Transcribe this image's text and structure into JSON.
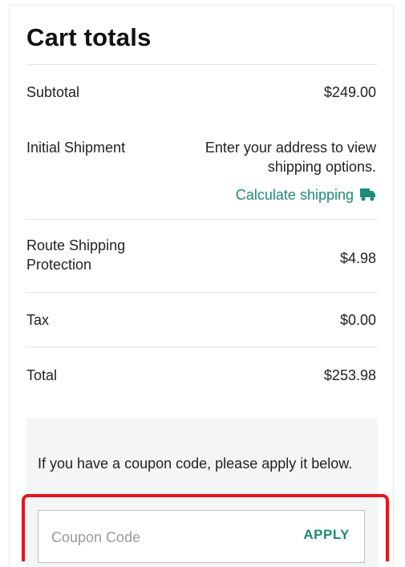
{
  "cart": {
    "title": "Cart totals",
    "subtotal_label": "Subtotal",
    "subtotal_value": "$249.00",
    "shipment_label": "Initial Shipment",
    "shipment_text": "Enter your address to view shipping options.",
    "calculate_shipping_label": "Calculate shipping",
    "route_label": "Route Shipping Protection",
    "route_value": "$4.98",
    "tax_label": "Tax",
    "tax_value": "$0.00",
    "total_label": "Total",
    "total_value": "$253.98"
  },
  "coupon": {
    "message": "If you have a coupon code, please apply it below.",
    "placeholder": "Coupon Code",
    "value": "",
    "apply_label": "APPLY"
  },
  "icons": {
    "calculate_shipping": "truck-icon"
  },
  "colors": {
    "accent": "#1f8a78",
    "highlight": "#e8141c",
    "coupon_bg": "#f4f5f7"
  }
}
